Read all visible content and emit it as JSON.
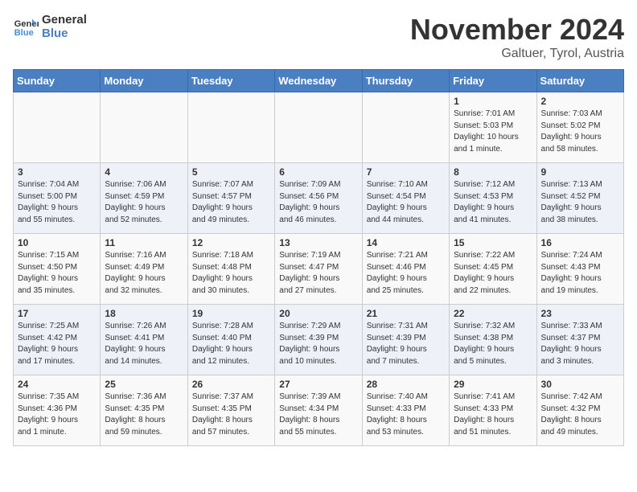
{
  "header": {
    "logo_line1": "General",
    "logo_line2": "Blue",
    "month": "November 2024",
    "location": "Galtuer, Tyrol, Austria"
  },
  "weekdays": [
    "Sunday",
    "Monday",
    "Tuesday",
    "Wednesday",
    "Thursday",
    "Friday",
    "Saturday"
  ],
  "weeks": [
    [
      {
        "day": "",
        "info": ""
      },
      {
        "day": "",
        "info": ""
      },
      {
        "day": "",
        "info": ""
      },
      {
        "day": "",
        "info": ""
      },
      {
        "day": "",
        "info": ""
      },
      {
        "day": "1",
        "info": "Sunrise: 7:01 AM\nSunset: 5:03 PM\nDaylight: 10 hours\nand 1 minute."
      },
      {
        "day": "2",
        "info": "Sunrise: 7:03 AM\nSunset: 5:02 PM\nDaylight: 9 hours\nand 58 minutes."
      }
    ],
    [
      {
        "day": "3",
        "info": "Sunrise: 7:04 AM\nSunset: 5:00 PM\nDaylight: 9 hours\nand 55 minutes."
      },
      {
        "day": "4",
        "info": "Sunrise: 7:06 AM\nSunset: 4:59 PM\nDaylight: 9 hours\nand 52 minutes."
      },
      {
        "day": "5",
        "info": "Sunrise: 7:07 AM\nSunset: 4:57 PM\nDaylight: 9 hours\nand 49 minutes."
      },
      {
        "day": "6",
        "info": "Sunrise: 7:09 AM\nSunset: 4:56 PM\nDaylight: 9 hours\nand 46 minutes."
      },
      {
        "day": "7",
        "info": "Sunrise: 7:10 AM\nSunset: 4:54 PM\nDaylight: 9 hours\nand 44 minutes."
      },
      {
        "day": "8",
        "info": "Sunrise: 7:12 AM\nSunset: 4:53 PM\nDaylight: 9 hours\nand 41 minutes."
      },
      {
        "day": "9",
        "info": "Sunrise: 7:13 AM\nSunset: 4:52 PM\nDaylight: 9 hours\nand 38 minutes."
      }
    ],
    [
      {
        "day": "10",
        "info": "Sunrise: 7:15 AM\nSunset: 4:50 PM\nDaylight: 9 hours\nand 35 minutes."
      },
      {
        "day": "11",
        "info": "Sunrise: 7:16 AM\nSunset: 4:49 PM\nDaylight: 9 hours\nand 32 minutes."
      },
      {
        "day": "12",
        "info": "Sunrise: 7:18 AM\nSunset: 4:48 PM\nDaylight: 9 hours\nand 30 minutes."
      },
      {
        "day": "13",
        "info": "Sunrise: 7:19 AM\nSunset: 4:47 PM\nDaylight: 9 hours\nand 27 minutes."
      },
      {
        "day": "14",
        "info": "Sunrise: 7:21 AM\nSunset: 4:46 PM\nDaylight: 9 hours\nand 25 minutes."
      },
      {
        "day": "15",
        "info": "Sunrise: 7:22 AM\nSunset: 4:45 PM\nDaylight: 9 hours\nand 22 minutes."
      },
      {
        "day": "16",
        "info": "Sunrise: 7:24 AM\nSunset: 4:43 PM\nDaylight: 9 hours\nand 19 minutes."
      }
    ],
    [
      {
        "day": "17",
        "info": "Sunrise: 7:25 AM\nSunset: 4:42 PM\nDaylight: 9 hours\nand 17 minutes."
      },
      {
        "day": "18",
        "info": "Sunrise: 7:26 AM\nSunset: 4:41 PM\nDaylight: 9 hours\nand 14 minutes."
      },
      {
        "day": "19",
        "info": "Sunrise: 7:28 AM\nSunset: 4:40 PM\nDaylight: 9 hours\nand 12 minutes."
      },
      {
        "day": "20",
        "info": "Sunrise: 7:29 AM\nSunset: 4:39 PM\nDaylight: 9 hours\nand 10 minutes."
      },
      {
        "day": "21",
        "info": "Sunrise: 7:31 AM\nSunset: 4:39 PM\nDaylight: 9 hours\nand 7 minutes."
      },
      {
        "day": "22",
        "info": "Sunrise: 7:32 AM\nSunset: 4:38 PM\nDaylight: 9 hours\nand 5 minutes."
      },
      {
        "day": "23",
        "info": "Sunrise: 7:33 AM\nSunset: 4:37 PM\nDaylight: 9 hours\nand 3 minutes."
      }
    ],
    [
      {
        "day": "24",
        "info": "Sunrise: 7:35 AM\nSunset: 4:36 PM\nDaylight: 9 hours\nand 1 minute."
      },
      {
        "day": "25",
        "info": "Sunrise: 7:36 AM\nSunset: 4:35 PM\nDaylight: 8 hours\nand 59 minutes."
      },
      {
        "day": "26",
        "info": "Sunrise: 7:37 AM\nSunset: 4:35 PM\nDaylight: 8 hours\nand 57 minutes."
      },
      {
        "day": "27",
        "info": "Sunrise: 7:39 AM\nSunset: 4:34 PM\nDaylight: 8 hours\nand 55 minutes."
      },
      {
        "day": "28",
        "info": "Sunrise: 7:40 AM\nSunset: 4:33 PM\nDaylight: 8 hours\nand 53 minutes."
      },
      {
        "day": "29",
        "info": "Sunrise: 7:41 AM\nSunset: 4:33 PM\nDaylight: 8 hours\nand 51 minutes."
      },
      {
        "day": "30",
        "info": "Sunrise: 7:42 AM\nSunset: 4:32 PM\nDaylight: 8 hours\nand 49 minutes."
      }
    ]
  ]
}
